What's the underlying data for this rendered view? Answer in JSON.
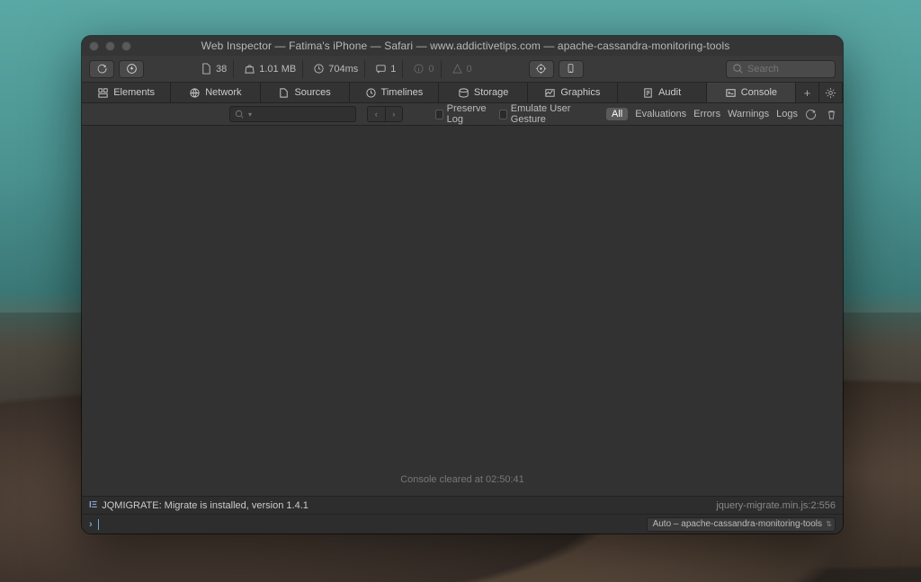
{
  "window": {
    "title": "Web Inspector — Fatima's iPhone — Safari — www.addictivetips.com — apache-cassandra-monitoring-tools"
  },
  "toolbar": {
    "resources": "38",
    "size": "1.01 MB",
    "time": "704ms",
    "requests": "1",
    "info": "0",
    "warnings": "0",
    "search_placeholder": "Search"
  },
  "tabs": {
    "elements": "Elements",
    "network": "Network",
    "sources": "Sources",
    "timelines": "Timelines",
    "storage": "Storage",
    "graphics": "Graphics",
    "audit": "Audit",
    "console": "Console"
  },
  "filter": {
    "preserve": "Preserve Log",
    "emulate": "Emulate User Gesture",
    "all": "All",
    "evaluations": "Evaluations",
    "errors": "Errors",
    "warnings": "Warnings",
    "logs": "Logs"
  },
  "console": {
    "cleared": "Console cleared at 02:50:41",
    "log_badge": "IΞ",
    "log_msg": "JQMIGRATE: Migrate is installed, version 1.4.1",
    "log_src": "jquery-migrate.min.js:2:556",
    "context": "Auto – apache-cassandra-monitoring-tools"
  }
}
